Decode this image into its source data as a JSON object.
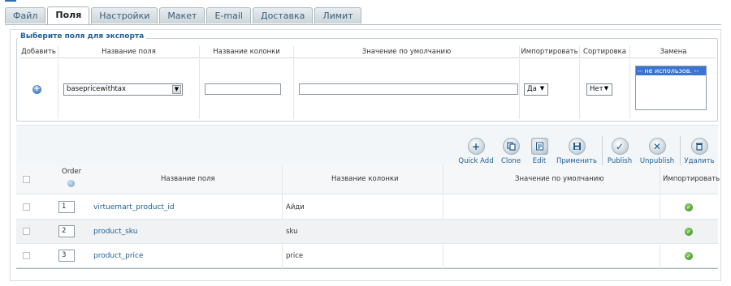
{
  "tabs": [
    {
      "label": "Файл"
    },
    {
      "label": "Поля"
    },
    {
      "label": "Настройки"
    },
    {
      "label": "Макет"
    },
    {
      "label": "E-mail"
    },
    {
      "label": "Доставка"
    },
    {
      "label": "Лимит"
    }
  ],
  "active_tab": "Поля",
  "export_fields": {
    "legend": "Выберите поля для экспорта",
    "headers": {
      "add": "Добавить",
      "field_name": "Название поля",
      "column_name": "Название колонки",
      "default_value": "Значение по умолчанию",
      "import": "Импортировать",
      "sort": "Сортировка",
      "replace": "Замена"
    },
    "field_select_value": "basepricewithtax",
    "column_name_value": "",
    "default_value_value": "",
    "import_select_value": "Да",
    "sort_select_value": "Нет",
    "replace_option": "-- не использов. --"
  },
  "toolbar": {
    "quick_add": "Quick Add",
    "clone": "Clone",
    "edit": "Edit",
    "apply": "Применить",
    "publish": "Publish",
    "unpublish": "Unpublish",
    "delete": "Удалить"
  },
  "grid": {
    "headers": {
      "order": "Order",
      "field_name": "Название поля",
      "column_name": "Название колонки",
      "default_value": "Значение по умолчанию",
      "import": "Импортировать"
    },
    "rows": [
      {
        "order": "1",
        "field": "virtuemart_product_id",
        "column": "Айди",
        "default": "",
        "imported": true
      },
      {
        "order": "2",
        "field": "product_sku",
        "column": "sku",
        "default": "",
        "imported": true
      },
      {
        "order": "3",
        "field": "product_price",
        "column": "price",
        "default": "",
        "imported": true
      }
    ]
  },
  "colors": {
    "accent": "#1f5f96",
    "ok": "#2f8a1e",
    "selection": "#3a74d4"
  }
}
